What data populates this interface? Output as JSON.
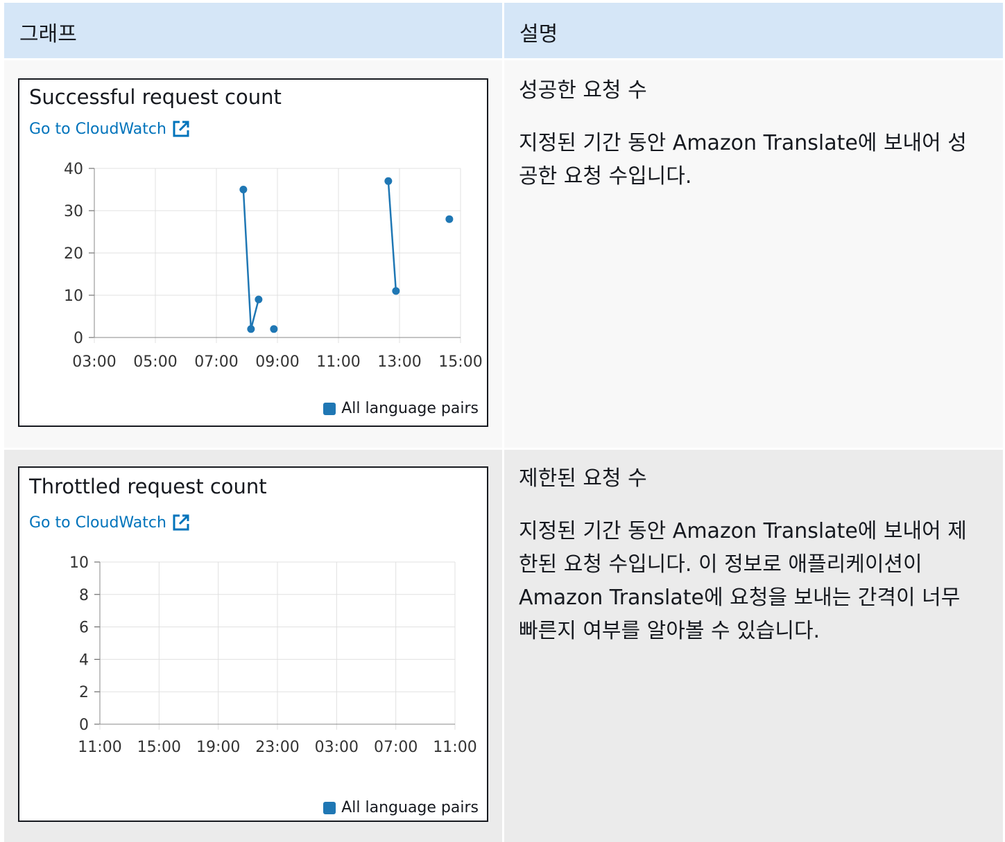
{
  "table": {
    "header_graph": "그래프",
    "header_description": "설명"
  },
  "rows": [
    {
      "panel_title": "Successful request count",
      "link_label": "Go to CloudWatch",
      "legend_label": "All language pairs",
      "desc_title": "성공한 요청 수",
      "desc_body": "지정된 기간 동안 Amazon Translate에 보내어 성공한 요청 수입니다."
    },
    {
      "panel_title": "Throttled request count",
      "link_label": "Go to CloudWatch",
      "legend_label": "All language pairs",
      "desc_title": "제한된 요청 수",
      "desc_body": "지정된 기간 동안 Amazon Translate에 보내어 제한된 요청 수입니다. 이 정보로 애플리케이션이 Amazon Translate에 요청을 보내는 간격이 너무 빠른지 여부를 알아볼 수 있습니다."
    }
  ],
  "colors": {
    "series": "#1f77b4",
    "link": "#0073bb",
    "header_bg": "#d5e6f7"
  },
  "icons": {
    "external_link": "external-link-icon"
  },
  "chart_data": [
    {
      "type": "line",
      "title": "Successful request count",
      "x_ticks": [
        "03:00",
        "05:00",
        "07:00",
        "09:00",
        "11:00",
        "13:00",
        "15:00"
      ],
      "y_ticks": [
        0,
        10,
        20,
        30,
        40
      ],
      "ylim": [
        0,
        40
      ],
      "grid": true,
      "legend": "bottom-right",
      "series": [
        {
          "name": "All language pairs",
          "points": [
            {
              "t": "07:53",
              "v": 35
            },
            {
              "t": "08:08",
              "v": 2
            },
            {
              "t": "08:23",
              "v": 9
            },
            null,
            {
              "t": "08:53",
              "v": 2
            },
            null,
            {
              "t": "12:38",
              "v": 37
            },
            {
              "t": "12:53",
              "v": 11
            },
            null,
            {
              "t": "14:38",
              "v": 28
            }
          ]
        }
      ]
    },
    {
      "type": "line",
      "title": "Throttled request count",
      "x_ticks": [
        "11:00",
        "15:00",
        "19:00",
        "23:00",
        "03:00",
        "07:00",
        "11:00"
      ],
      "y_ticks": [
        0,
        2,
        4,
        6,
        8,
        10
      ],
      "ylim": [
        0,
        10
      ],
      "grid": true,
      "legend": "bottom-right",
      "series": [
        {
          "name": "All language pairs",
          "points": []
        }
      ]
    }
  ]
}
